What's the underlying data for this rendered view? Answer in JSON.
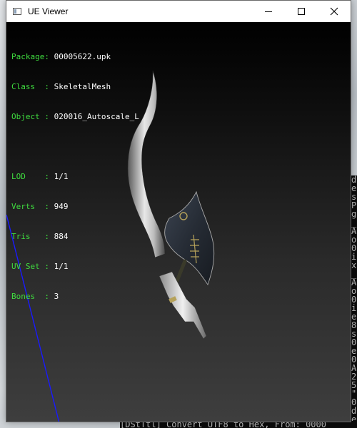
{
  "window": {
    "title": "UE Viewer",
    "controls": [
      "minimize",
      "maximize",
      "close"
    ]
  },
  "mesh_info": {
    "package": {
      "key": "Package: ",
      "value": "00005622.upk"
    },
    "class": {
      "key": "Class  : ",
      "value": "SkeletalMesh"
    },
    "object": {
      "key": "Object : ",
      "value": "020016_Autoscale_L"
    },
    "lod": {
      "key": "LOD    : ",
      "value": "1/1"
    },
    "verts": {
      "key": "Verts  : ",
      "value": "949"
    },
    "tris": {
      "key": "Tris   : ",
      "value": "884"
    },
    "uvset": {
      "key": "UV Set : ",
      "value": "1/1"
    },
    "bones": {
      "key": "Bones  : ",
      "value": "3"
    }
  },
  "background_console": {
    "right_column": [
      "d",
      "e",
      "s",
      "P",
      "g",
      "_",
      "A",
      "o",
      "0",
      "i",
      "x",
      "_",
      "A",
      "o",
      "0",
      "i",
      "e",
      "8",
      "s",
      "0",
      "e",
      "0",
      "A",
      "2",
      "5",
      "\"",
      "0",
      "d",
      "e"
    ],
    "bottom_line": "[DStTtl] Convert UTF8 to Hex, From: 0000"
  },
  "colors": {
    "label_green": "#3fdc3f",
    "value_white": "#ffffff",
    "axis_blue": "#1a1aff"
  }
}
